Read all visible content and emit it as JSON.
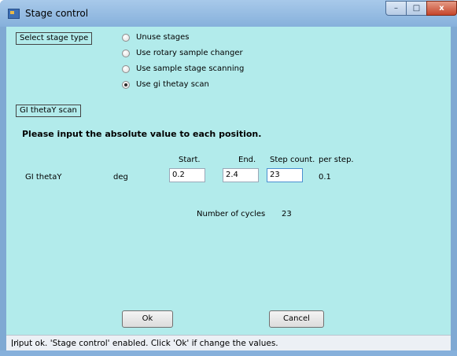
{
  "window": {
    "title": "Stage control",
    "minimize": "–",
    "maximize": "□",
    "close": "x"
  },
  "stage_type": {
    "label": "Select stage type",
    "options": [
      {
        "label": "Unuse stages",
        "selected": false
      },
      {
        "label": "Use rotary sample changer",
        "selected": false
      },
      {
        "label": "Use sample stage scanning",
        "selected": false
      },
      {
        "label": "Use gi thetay scan",
        "selected": true
      }
    ]
  },
  "scan": {
    "label": "GI thetaY scan",
    "instruction": "Please input the absolute value to each position.",
    "headers": {
      "start": "Start.",
      "end": "End.",
      "step_count": "Step count.",
      "per_step": "per step."
    },
    "row": {
      "name": "GI thetaY",
      "unit": "deg",
      "start": "0.2",
      "end": "2.4",
      "step_count": "23",
      "per_step": "0.1"
    },
    "cycles_label": "Number of cycles",
    "cycles_value": "23"
  },
  "buttons": {
    "ok": "Ok",
    "cancel": "Cancel"
  },
  "status": "Input ok. 'Stage control' enabled. Click 'Ok' if change the values.",
  "colors": {
    "client_bg": "#b2ebeb",
    "frame": "#86b0db",
    "close_button": "#c5452b"
  }
}
